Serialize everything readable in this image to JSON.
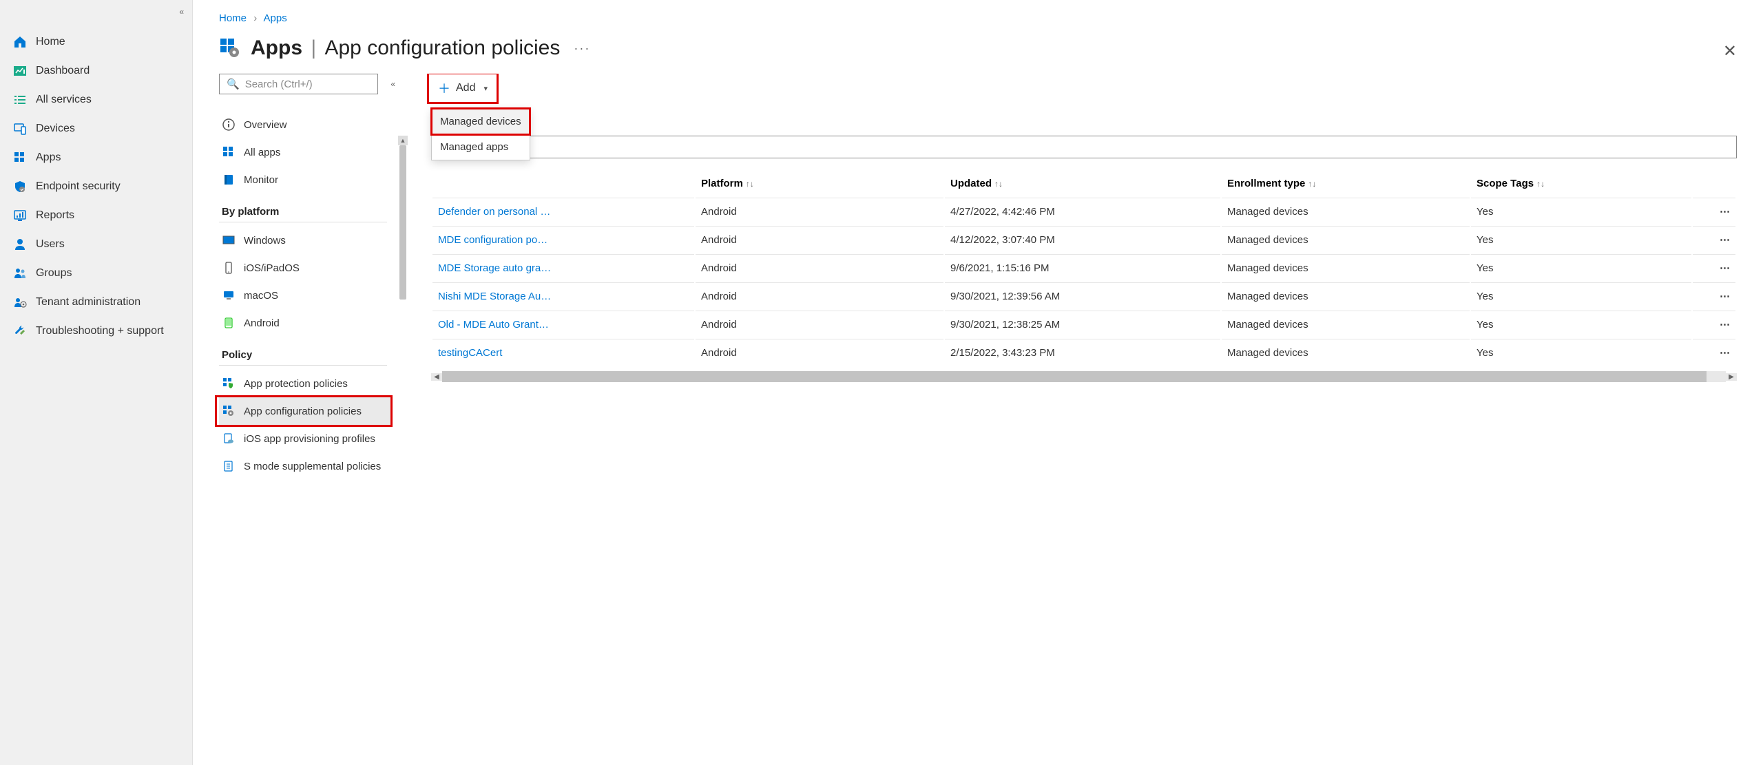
{
  "breadcrumb": {
    "home": "Home",
    "apps": "Apps"
  },
  "header": {
    "title_main": "Apps",
    "title_sub": "App configuration policies"
  },
  "global_nav": {
    "items": [
      {
        "label": "Home"
      },
      {
        "label": "Dashboard"
      },
      {
        "label": "All services"
      },
      {
        "label": "Devices"
      },
      {
        "label": "Apps"
      },
      {
        "label": "Endpoint security"
      },
      {
        "label": "Reports"
      },
      {
        "label": "Users"
      },
      {
        "label": "Groups"
      },
      {
        "label": "Tenant administration"
      },
      {
        "label": "Troubleshooting + support"
      }
    ]
  },
  "subnav": {
    "search_placeholder": "Search (Ctrl+/)",
    "items": [
      {
        "label": "Overview"
      },
      {
        "label": "All apps"
      },
      {
        "label": "Monitor"
      }
    ],
    "group_platform_label": "By platform",
    "platforms": [
      {
        "label": "Windows"
      },
      {
        "label": "iOS/iPadOS"
      },
      {
        "label": "macOS"
      },
      {
        "label": "Android"
      }
    ],
    "group_policy_label": "Policy",
    "policies": [
      {
        "label": "App protection policies"
      },
      {
        "label": "App configuration policies"
      },
      {
        "label": "iOS app provisioning profiles"
      },
      {
        "label": "S mode supplemental policies"
      }
    ]
  },
  "toolbar": {
    "add_label": "Add",
    "dropdown": {
      "managed_devices": "Managed devices",
      "managed_apps": "Managed apps"
    }
  },
  "table": {
    "search_placeholder": "",
    "headers": {
      "name": "",
      "platform": "Platform",
      "updated": "Updated",
      "enrollment": "Enrollment type",
      "scope": "Scope Tags"
    },
    "rows": [
      {
        "name": "Defender on personal …",
        "platform": "Android",
        "updated": "4/27/2022, 4:42:46 PM",
        "enrollment": "Managed devices",
        "scope": "Yes"
      },
      {
        "name": "MDE configuration po…",
        "platform": "Android",
        "updated": "4/12/2022, 3:07:40 PM",
        "enrollment": "Managed devices",
        "scope": "Yes"
      },
      {
        "name": "MDE Storage auto gra…",
        "platform": "Android",
        "updated": "9/6/2021, 1:15:16 PM",
        "enrollment": "Managed devices",
        "scope": "Yes"
      },
      {
        "name": "Nishi MDE Storage Au…",
        "platform": "Android",
        "updated": "9/30/2021, 12:39:56 AM",
        "enrollment": "Managed devices",
        "scope": "Yes"
      },
      {
        "name": "Old - MDE Auto Grant…",
        "platform": "Android",
        "updated": "9/30/2021, 12:38:25 AM",
        "enrollment": "Managed devices",
        "scope": "Yes"
      },
      {
        "name": "testingCACert",
        "platform": "Android",
        "updated": "2/15/2022, 3:43:23 PM",
        "enrollment": "Managed devices",
        "scope": "Yes"
      }
    ]
  }
}
